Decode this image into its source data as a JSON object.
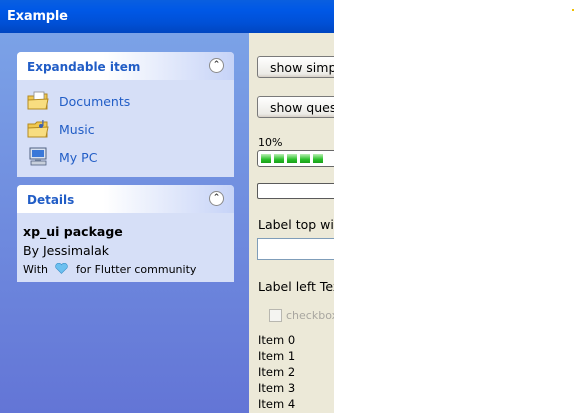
{
  "window": {
    "title": "Example"
  },
  "sidebar": {
    "expandable_panel": {
      "title": "Expandable item",
      "items": [
        {
          "label": "Documents",
          "icon": "documents-folder-icon"
        },
        {
          "label": "Music",
          "icon": "music-folder-icon"
        },
        {
          "label": "My PC",
          "icon": "my-pc-icon"
        }
      ]
    },
    "details_panel": {
      "title": "Details",
      "name": "xp_ui package",
      "author": "By Jessimalak",
      "credit_prefix": "With",
      "credit_suffix": "for Flutter community",
      "heart_icon": "heart-icon"
    }
  },
  "main": {
    "show_simple_button": "show simp",
    "show_question_button": "show ques",
    "progress": {
      "label": "10%",
      "value": 0.1
    },
    "label_top": "Label top wi",
    "label_left": "Label left Tex",
    "checkbox_label": "checkbox",
    "list_items": [
      "Item 0",
      "Item 1",
      "Item 2",
      "Item 3",
      "Item 4"
    ]
  },
  "colors": {
    "titlebar": "#0055e5",
    "link": "#215dc6",
    "progress_fill": "#2ac02a",
    "window_bg": "#ece9d8"
  }
}
